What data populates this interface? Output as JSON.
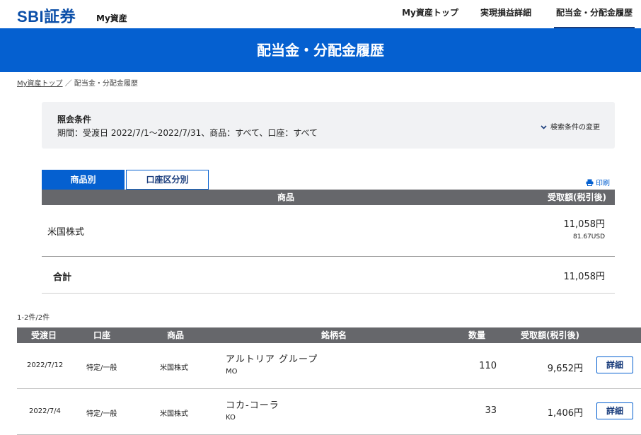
{
  "header": {
    "logo": "SBI証券",
    "logo_sub": "My資産",
    "nav": [
      "My資産トップ",
      "実現損益詳細",
      "配当金・分配金履歴"
    ]
  },
  "banner": {
    "title": "配当金・分配金履歴"
  },
  "breadcrumb": {
    "link": "My資産トップ",
    "sep": "／",
    "current": "配当金・分配金履歴"
  },
  "conditions": {
    "title": "照会条件",
    "text": "期間：受渡日 2022/7/1〜2022/7/31、商品：すべて、口座：すべて",
    "change_label": "検索条件の変更"
  },
  "tabs": [
    "商品別",
    "口座区分別"
  ],
  "print_label": "印刷",
  "summary": {
    "headers": [
      "商品",
      "受取額(税引後)"
    ],
    "row": {
      "name": "米国株式",
      "amount": "11,058円",
      "usd": "81.67USD"
    },
    "total": {
      "name": "合計",
      "amount": "11,058円"
    }
  },
  "count_text": "1-2件/2件",
  "detail": {
    "headers": [
      "受渡日",
      "口座",
      "商品",
      "銘柄名",
      "数量",
      "受取額(税引後)"
    ],
    "button_label": "詳細",
    "rows": [
      {
        "date": "2022/7/12",
        "account": "特定/一般",
        "product": "米国株式",
        "security": "アルトリア グループ",
        "ticker": "MO",
        "qty": "110",
        "amount": "9,652円"
      },
      {
        "date": "2022/7/4",
        "account": "特定/一般",
        "product": "米国株式",
        "security": "コカ-コーラ",
        "ticker": "KO",
        "qty": "33",
        "amount": "1,406円"
      }
    ]
  },
  "colors": {
    "brand_blue": "#0560d0",
    "table_header": "#66676b",
    "nav_active": "#1a3d7c"
  }
}
